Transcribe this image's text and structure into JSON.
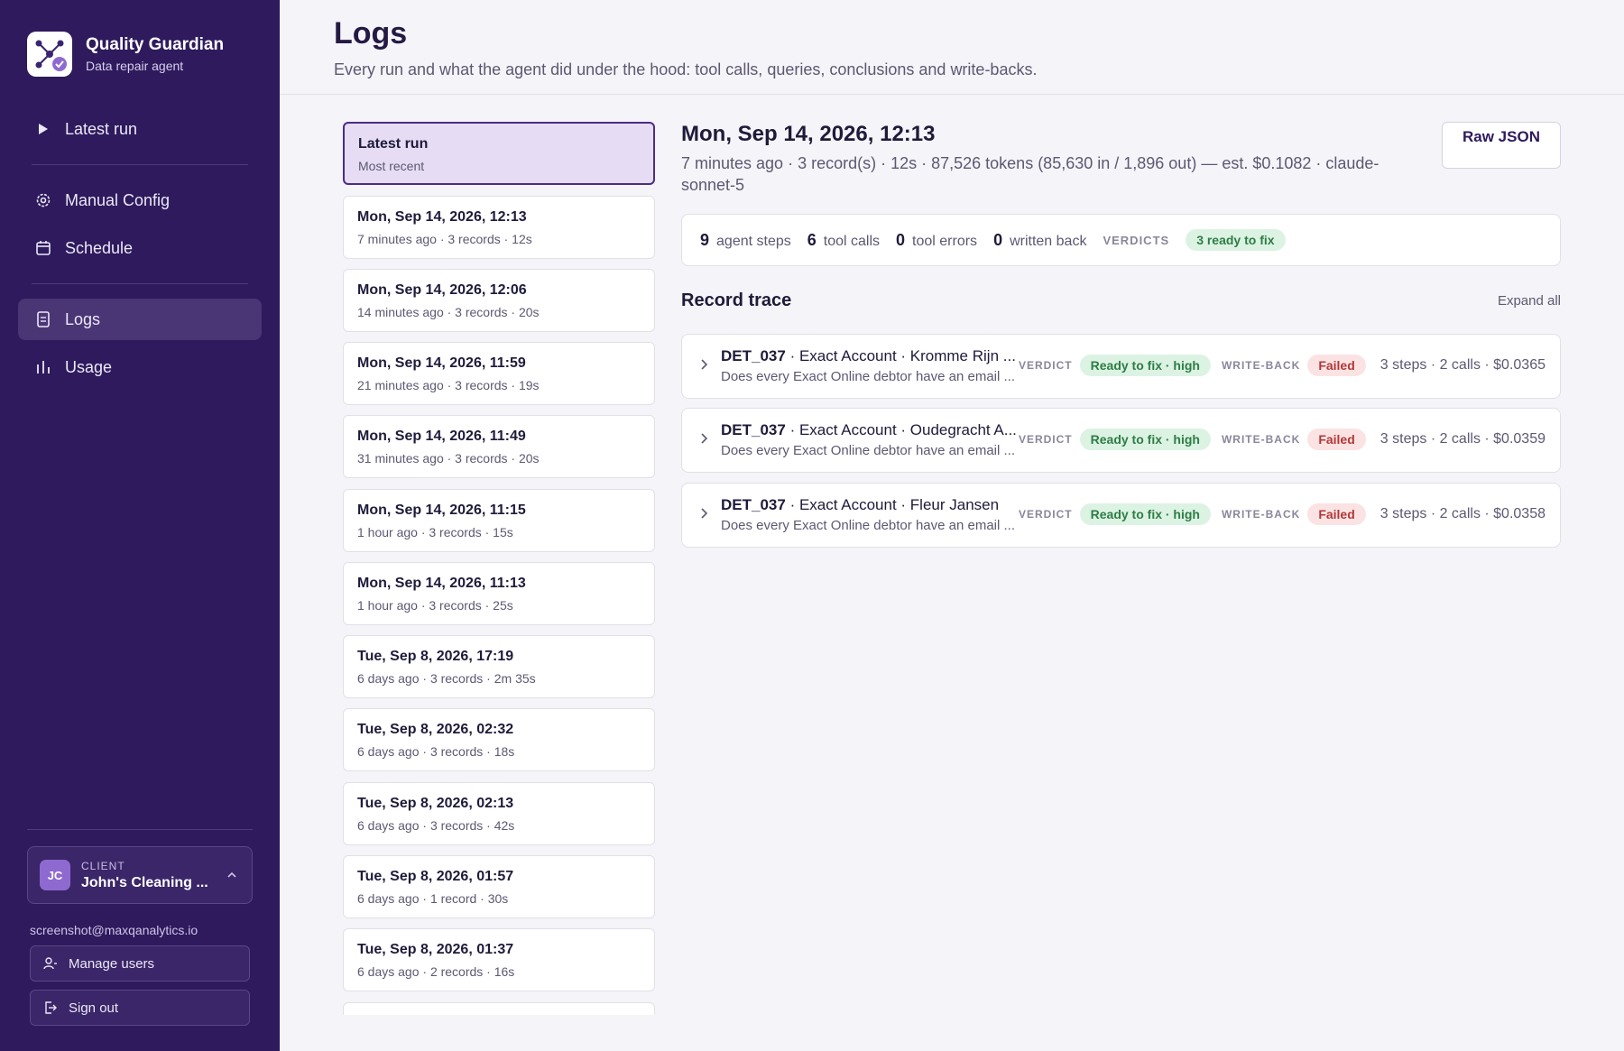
{
  "brand": {
    "title": "Quality Guardian",
    "subtitle": "Data repair agent"
  },
  "nav": {
    "latest_run": "Latest run",
    "manual_config": "Manual Config",
    "schedule": "Schedule",
    "logs": "Logs",
    "usage": "Usage"
  },
  "client": {
    "label": "CLIENT",
    "initials": "JC",
    "name": "John's Cleaning ..."
  },
  "account": {
    "email": "screenshot@maxqanalytics.io",
    "manage_users": "Manage users",
    "sign_out": "Sign out"
  },
  "header": {
    "title": "Logs",
    "subtitle": "Every run and what the agent did under the hood: tool calls, queries, conclusions and write-backs."
  },
  "runs": [
    {
      "title": "Latest run",
      "meta": "Most recent"
    },
    {
      "title": "Mon, Sep 14, 2026, 12:13",
      "meta": "7 minutes ago · 3 records · 12s"
    },
    {
      "title": "Mon, Sep 14, 2026, 12:06",
      "meta": "14 minutes ago · 3 records · 20s"
    },
    {
      "title": "Mon, Sep 14, 2026, 11:59",
      "meta": "21 minutes ago · 3 records · 19s"
    },
    {
      "title": "Mon, Sep 14, 2026, 11:49",
      "meta": "31 minutes ago · 3 records · 20s"
    },
    {
      "title": "Mon, Sep 14, 2026, 11:15",
      "meta": "1 hour ago · 3 records · 15s"
    },
    {
      "title": "Mon, Sep 14, 2026, 11:13",
      "meta": "1 hour ago · 3 records · 25s"
    },
    {
      "title": "Tue, Sep 8, 2026, 17:19",
      "meta": "6 days ago · 3 records · 2m 35s"
    },
    {
      "title": "Tue, Sep 8, 2026, 02:32",
      "meta": "6 days ago · 3 records · 18s"
    },
    {
      "title": "Tue, Sep 8, 2026, 02:13",
      "meta": "6 days ago · 3 records · 42s"
    },
    {
      "title": "Tue, Sep 8, 2026, 01:57",
      "meta": "6 days ago · 1 record · 30s"
    },
    {
      "title": "Tue, Sep 8, 2026, 01:37",
      "meta": "6 days ago · 2 records · 16s"
    }
  ],
  "detail": {
    "title": "Mon, Sep 14, 2026, 12:13",
    "meta": "7 minutes ago · 3 record(s) · 12s · 87,526 tokens (85,630 in / 1,896 out) — est. $0.1082 · claude-sonnet-5",
    "raw_json": "Raw JSON",
    "stats": {
      "agent_steps": "9",
      "agent_steps_label": "agent steps",
      "tool_calls": "6",
      "tool_calls_label": "tool calls",
      "tool_errors": "0",
      "tool_errors_label": "tool errors",
      "written_back": "0",
      "written_back_label": "written back",
      "verdicts_label": "VERDICTS",
      "verdict_pill": "3 ready to fix"
    },
    "trace_title": "Record trace",
    "expand_all": "Expand all",
    "verdict_label": "VERDICT",
    "writeback_label": "WRITE-BACK",
    "records": [
      {
        "id": "DET_037",
        "desc": "· Exact Account · Kromme Rijn ...",
        "question": "Does every Exact Online debtor have an email ...",
        "verdict": "Ready to fix · high",
        "writeback": "Failed",
        "summary": "3 steps · 2 calls · $0.0365"
      },
      {
        "id": "DET_037",
        "desc": "· Exact Account · Oudegracht A...",
        "question": "Does every Exact Online debtor have an email ...",
        "verdict": "Ready to fix · high",
        "writeback": "Failed",
        "summary": "3 steps · 2 calls · $0.0359"
      },
      {
        "id": "DET_037",
        "desc": "· Exact Account · Fleur Jansen",
        "question": "Does every Exact Online debtor have an email ...",
        "verdict": "Ready to fix · high",
        "writeback": "Failed",
        "summary": "3 steps · 2 calls · $0.0358"
      }
    ]
  }
}
